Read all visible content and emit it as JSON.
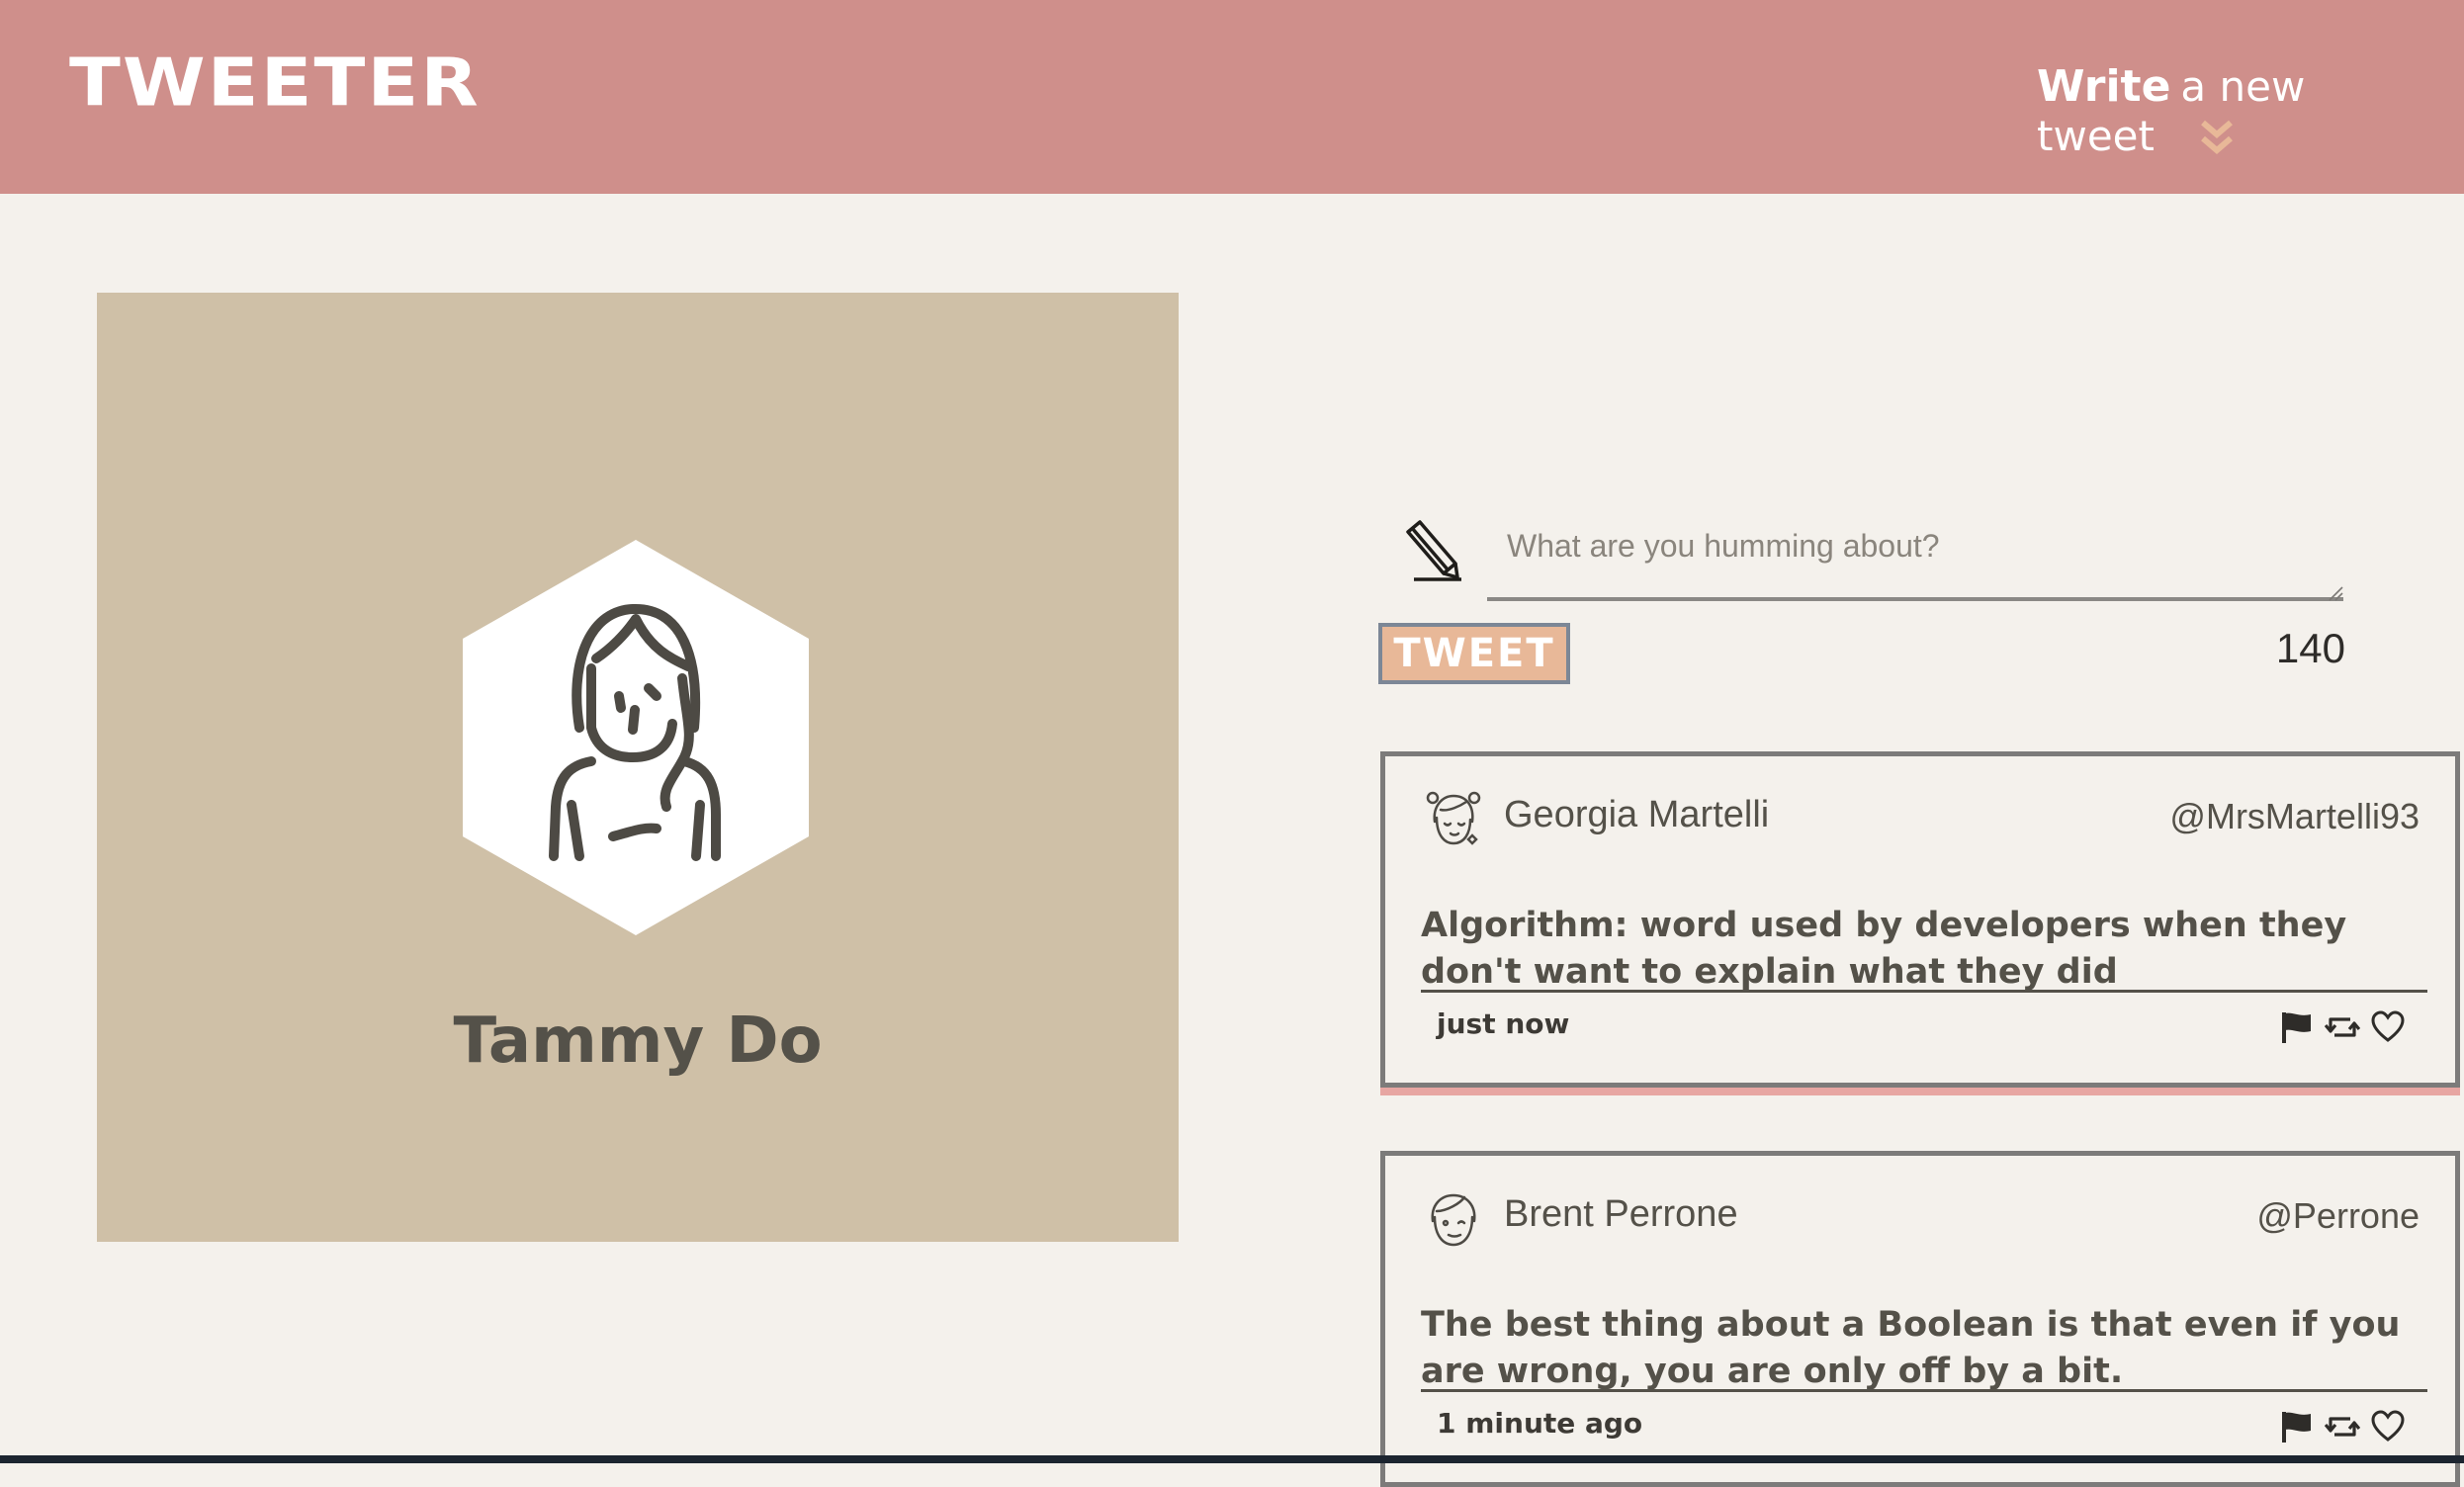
{
  "header": {
    "brand": "TWEETER",
    "compose_toggle": {
      "bold_label": "Write",
      "label": "a new tweet",
      "icon": "chevrons-down-icon"
    }
  },
  "profile": {
    "name": "Tammy Do",
    "avatar_icon": "user-avatar-icon"
  },
  "compose": {
    "placeholder": "What are you humming about?",
    "value": "",
    "icon": "pencil-icon",
    "button_label": "TWEET",
    "counter": "140"
  },
  "tweets": [
    {
      "name": "Georgia Martelli",
      "handle": "@MrsMartelli93",
      "content": "Algorithm: word used by developers when they don't want to explain what they did",
      "time": "just now",
      "avatar_icon": "user-avatar-icon"
    },
    {
      "name": "Brent Perrone",
      "handle": "@Perrone",
      "content": "The best thing about a Boolean is that even if you are wrong, you are only off by a bit.",
      "time": "1 minute ago",
      "avatar_icon": "user-avatar-icon"
    }
  ],
  "colors": {
    "header": "#cf8f8b",
    "page_background": "#f4f1ec",
    "profile_card": "#cfc0a7",
    "button": "#e8b898",
    "text": "#545149",
    "accent": "#e8b898"
  }
}
